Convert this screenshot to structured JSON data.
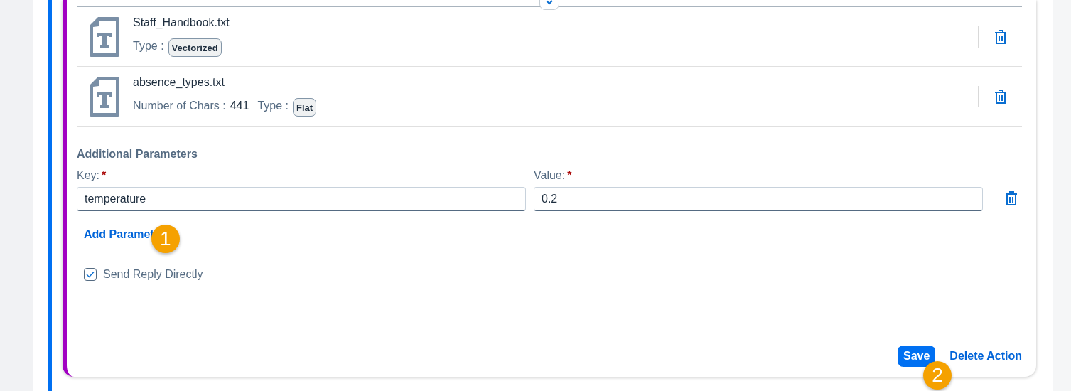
{
  "files": [
    {
      "name": "Staff_Handbook.txt",
      "type_label": "Type :",
      "type": "Vectorized"
    },
    {
      "name": "absence_types.txt",
      "chars_label": "Number of Chars :",
      "chars": "441",
      "type_label": "Type :",
      "type": "Flat"
    }
  ],
  "additional_parameters": {
    "title": "Additional Parameters",
    "key_label": "Key:",
    "value_label": "Value:",
    "required_mark": "*",
    "rows": [
      {
        "key": "temperature",
        "value": "0.2"
      }
    ],
    "add_link": "Add Paramet",
    "callout": "1"
  },
  "send_reply": {
    "label": "Send Reply Directly",
    "checked": true
  },
  "actions": {
    "save": "Save",
    "delete": "Delete Action",
    "callout": "2"
  }
}
